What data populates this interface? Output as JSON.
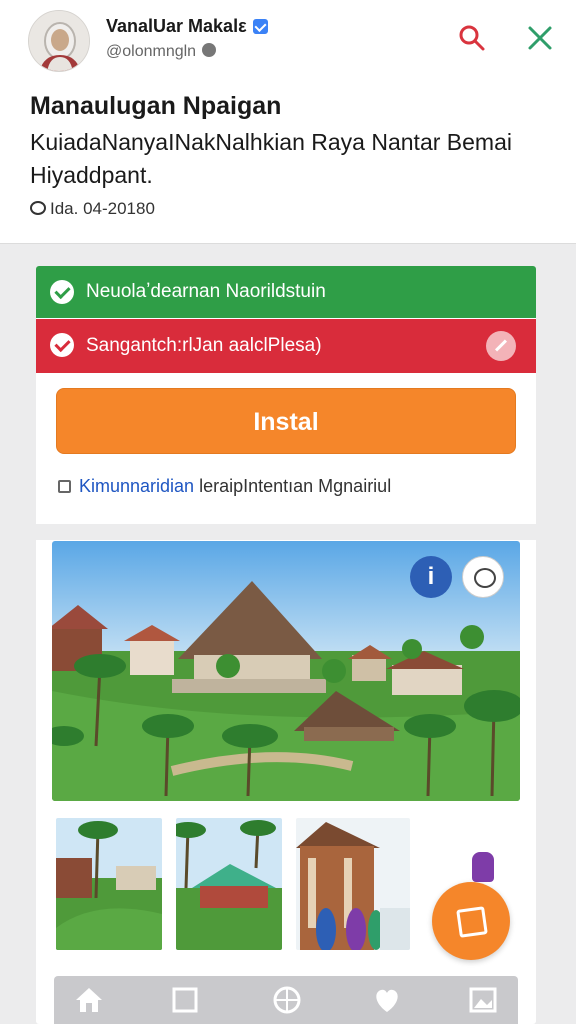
{
  "header": {
    "account_name": "VanalUar Makalε",
    "account_handle": "@olonmngln",
    "icons": [
      "search-icon",
      "close-icon",
      "verified-badge-icon",
      "globe-icon"
    ]
  },
  "post": {
    "title": "Manaulugan Npaigan",
    "body": "KuiadaNanyaINakNalhkian Raya Nantar Bemai Hiyaddpant.",
    "meta": "Ida. 04-20180"
  },
  "ad": {
    "green_bar_label": "Neuolaʼdearnan Naorildstuin",
    "red_bar_label": "Sangantch:rlJan aalclPlesa)",
    "install_label": "Instal",
    "promo_link": "Kimunnaridian",
    "promo_text": " leraipIntentıan Mgnairiul",
    "hero_info_label": "i"
  },
  "tabbar": {
    "items": [
      "home-icon",
      "square-icon",
      "globe-icon",
      "heart-icon",
      "image-icon"
    ]
  },
  "colors": {
    "green": "#2f9e47",
    "red": "#d92c3b",
    "orange": "#f5862a",
    "blue": "#2d5fb5",
    "link": "#1f56c2"
  }
}
